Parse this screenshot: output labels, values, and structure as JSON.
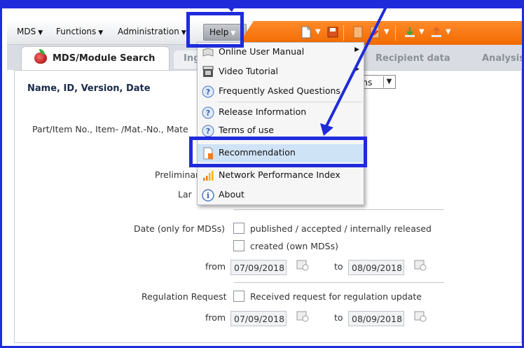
{
  "menubar": {
    "items": [
      "MDS",
      "Functions",
      "Administration"
    ],
    "help_label": "Help"
  },
  "tabs": {
    "active": "MDS/Module Search",
    "others": [
      "Ing",
      "Recipient data",
      "Analysis"
    ]
  },
  "form": {
    "section_title": "Name, ID, Version, Date",
    "part_label": "Part/Item No., Item- /Mat.-No., Mate",
    "version_select_value": "ions",
    "preliminary_label": "Preliminar",
    "language_label": "Lar",
    "date_label": "Date (only for MDSs)",
    "opt_published": "published / accepted / internally released",
    "opt_created": "created (own MDSs)",
    "from_label": "from",
    "to_label": "to",
    "from_date_1": "07/09/2018",
    "to_date_1": "08/09/2018",
    "regulation_label": "Regulation Request",
    "regulation_option": "Received request for regulation update",
    "from_date_2": "07/09/2018",
    "to_date_2": "08/09/2018"
  },
  "help_menu": {
    "items": [
      {
        "label": "Online User Manual",
        "icon": "manual-icon"
      },
      {
        "label": "Video Tutorial",
        "icon": "film-icon"
      },
      {
        "label": "Frequently Asked Questions",
        "icon": "question-icon"
      },
      {
        "label": "Release Information",
        "icon": "question-icon"
      },
      {
        "label": "Terms of use",
        "icon": "question-icon"
      },
      {
        "label": "Recommendation",
        "icon": "recommendation-icon"
      },
      {
        "label": "Network Performance Index",
        "icon": "signal-bars-icon"
      },
      {
        "label": "About",
        "icon": "info-icon"
      }
    ]
  },
  "colors": {
    "annotation": "#1f2bdb",
    "toolbar_orange": "#f47a14",
    "highlight": "#cfe3f7"
  }
}
